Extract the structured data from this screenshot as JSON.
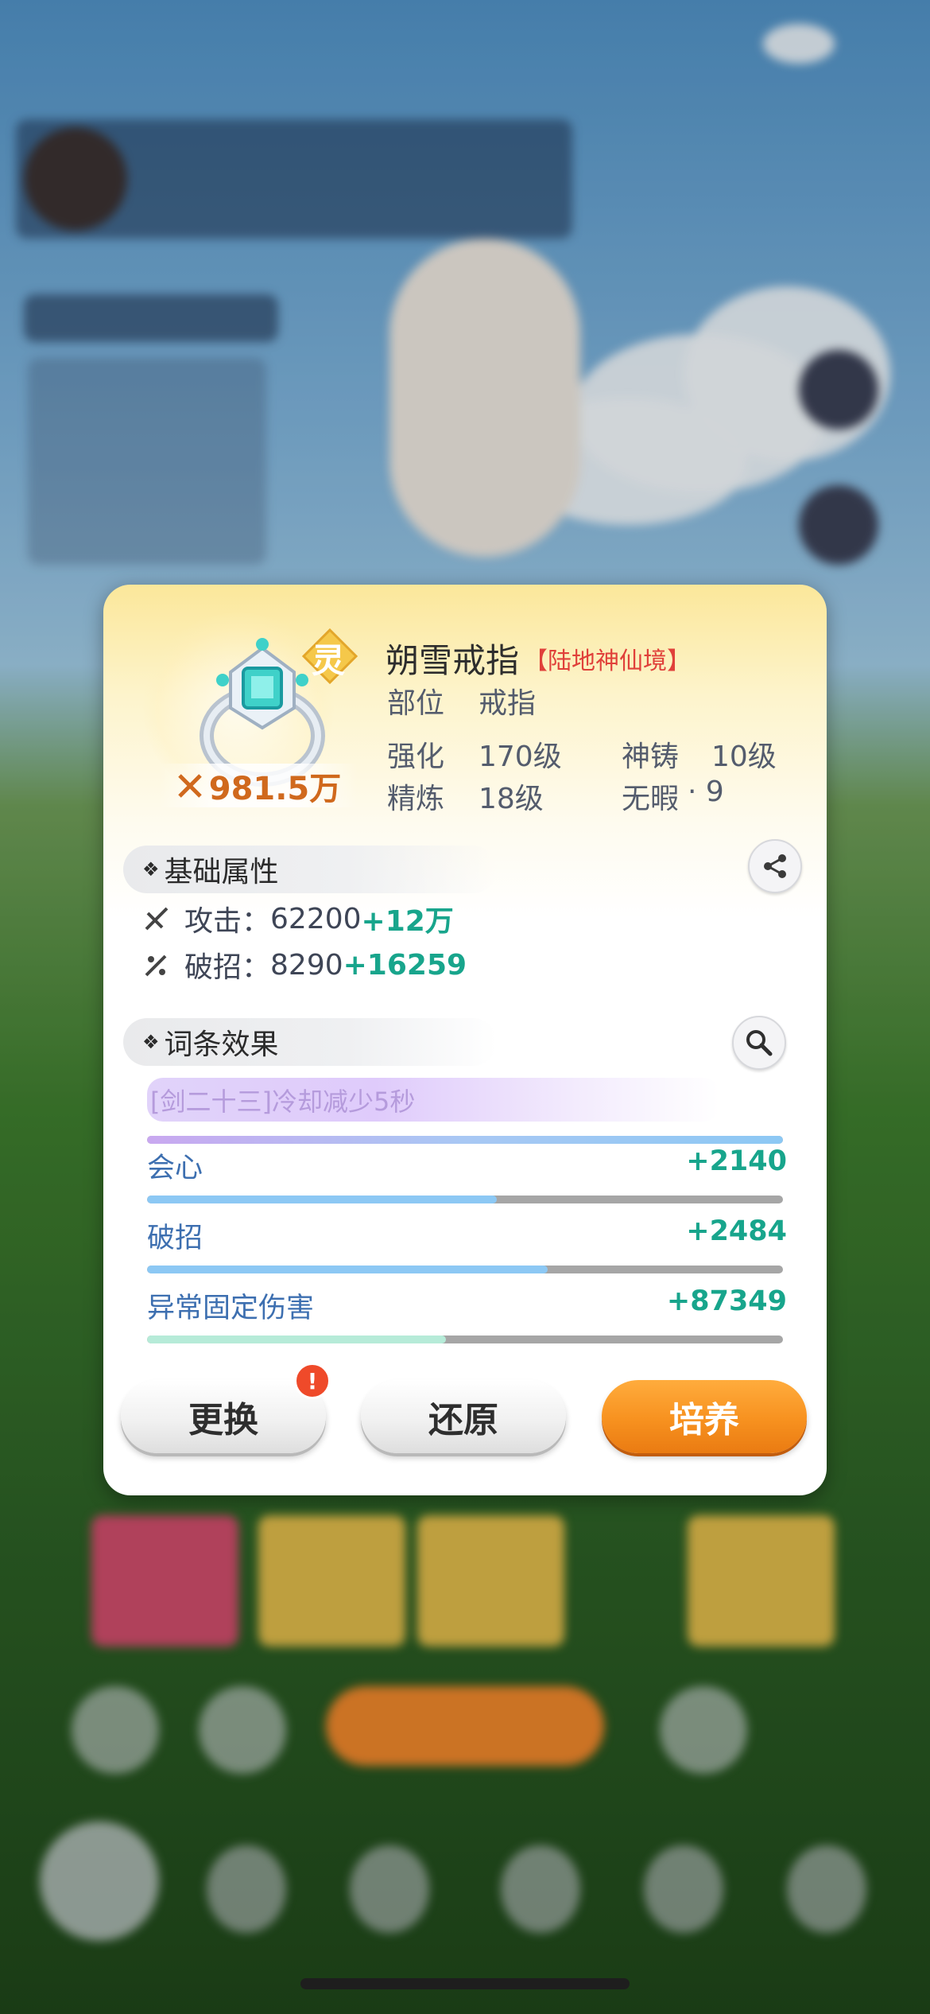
{
  "dialog": {
    "item_name": "朔雪戒指",
    "realm": "【陆地神仙境】",
    "badge": "灵",
    "power": "981.5万",
    "slot_label": "部位",
    "slot_value": "戒指",
    "enhance_label": "强化",
    "enhance_value": "170级",
    "forge_label": "神铸",
    "forge_value": "10级",
    "refine_label": "精炼",
    "refine_value": "18级",
    "flawless_label": "无暇",
    "flawless_value": "· 9"
  },
  "base_section": {
    "title": "基础属性",
    "stats": [
      {
        "label": "攻击：",
        "base": "62200",
        "bonus": "+12万"
      },
      {
        "label": "破招：",
        "base": "8290",
        "bonus": "+16259"
      }
    ]
  },
  "effect_section": {
    "title": "词条效果",
    "special": "[剑二十三]冷却减少5秒",
    "entries": [
      {
        "name": "会心",
        "value": "+2140",
        "fill": 0.55,
        "color": "#8cc8f4"
      },
      {
        "name": "破招",
        "value": "+2484",
        "fill": 0.63,
        "color": "#8cc8f4"
      },
      {
        "name": "异常固定伤害",
        "value": "+87349",
        "fill": 0.47,
        "color": "#b6ebd8"
      }
    ],
    "special_bar_color": "#8cc8f4"
  },
  "buttons": {
    "replace": "更换",
    "restore": "还原",
    "cultivate": "培养",
    "alert": "!"
  },
  "colors": {
    "accent_orange": "#f7911f",
    "bonus_green": "#18a58c",
    "realm_red": "#e0403a"
  }
}
